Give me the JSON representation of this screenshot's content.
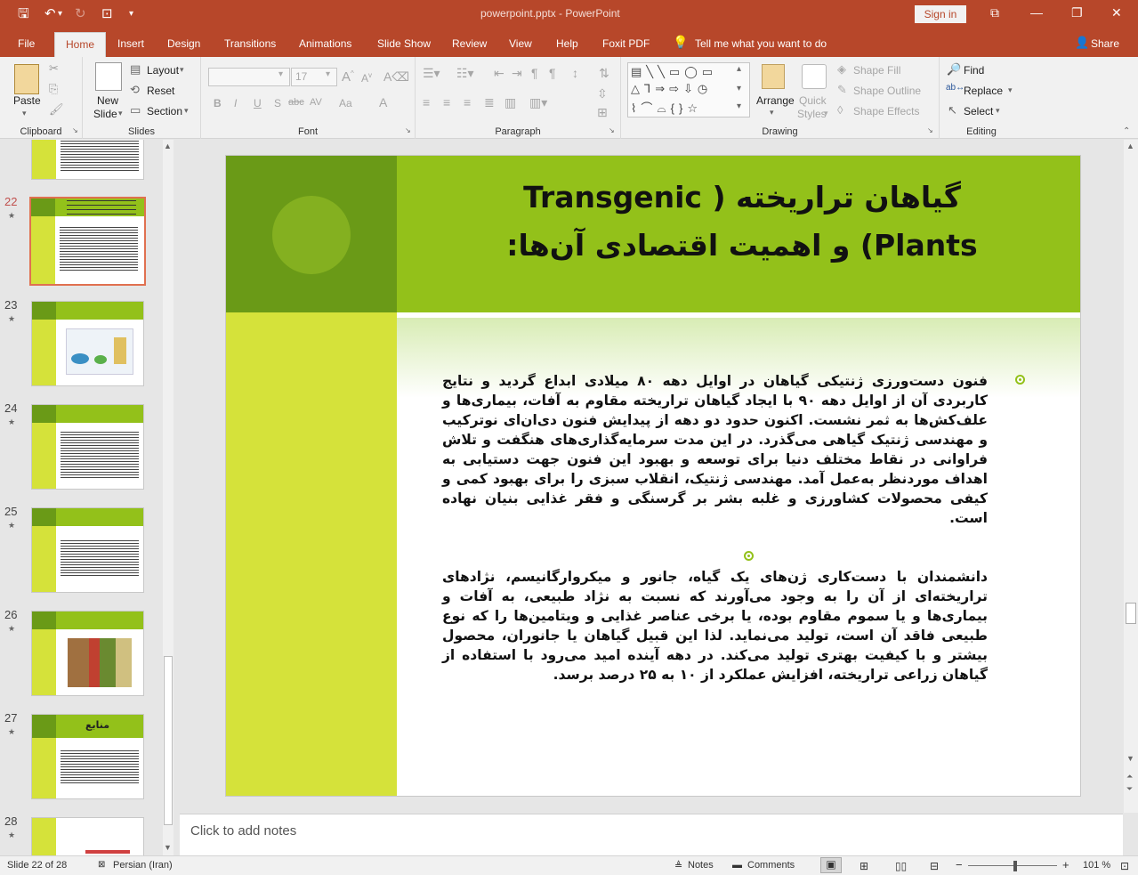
{
  "titlebar": {
    "title": "powerpoint.pptx  -  PowerPoint",
    "signin": "Sign in",
    "save_icon": "save-icon",
    "undo_icon": "undo-icon",
    "redo_icon": "redo-icon",
    "min": "—",
    "restore": "❐",
    "close": "✕",
    "restore_icon": "⧉"
  },
  "tabs": [
    "File",
    "Home",
    "Insert",
    "Design",
    "Transitions",
    "Animations",
    "Slide Show",
    "Review",
    "View",
    "Help",
    "Foxit PDF"
  ],
  "tell_me": "Tell me what you want to do",
  "share": "Share",
  "ribbon": {
    "clipboard": {
      "paste": "Paste",
      "label": "Clipboard"
    },
    "slides": {
      "new_slide": "New",
      "new_slide2": "Slide",
      "layout": "Layout",
      "reset": "Reset",
      "section": "Section",
      "label": "Slides"
    },
    "font": {
      "size": "17",
      "label": "Font",
      "b": "B",
      "i": "I",
      "u": "U",
      "s": "S",
      "abc": "abc",
      "av": "AV",
      "aa": "Aa",
      "a": "A"
    },
    "paragraph": {
      "label": "Paragraph"
    },
    "drawing": {
      "arrange": "Arrange",
      "quick": "Quick",
      "styles": "Styles",
      "shape_fill": "Shape Fill",
      "shape_outline": "Shape Outline",
      "shape_effects": "Shape Effects",
      "label": "Drawing"
    },
    "editing": {
      "find": "Find",
      "replace": "Replace",
      "select": "Select",
      "label": "Editing"
    }
  },
  "thumbnails": [
    {
      "num": "22",
      "star": "★"
    },
    {
      "num": "23",
      "star": "★"
    },
    {
      "num": "24",
      "star": "★"
    },
    {
      "num": "25",
      "star": "★"
    },
    {
      "num": "26",
      "star": "★"
    },
    {
      "num": "27",
      "star": "★",
      "title": "منابع"
    },
    {
      "num": "28",
      "star": "★"
    }
  ],
  "slide": {
    "title_line1": "گیاهان تراریخته ( Transgenic",
    "title_line2": "Plants) و اهمیت اقتصادی آن‌ها:",
    "para1": "فنون دست‌ورزی ژنتیکی گیاهان در اوایل دهه ۸۰ میلادی ابداع گردید و نتایج کاربردی آن از اوایل دهه ۹۰ با ایجاد گیاهان تراریخته مقاوم به آفات، بیماری‌ها و علف‌کش‌ها به ثمر نشست. اکنون حدود دو دهه از پیدایش فنون دی‌ان‌ای نوترکیب و مهندسی ژنتیک گیاهی می‌گذرد. در این مدت سرمایه‌گذاری‌های هنگفت و تلاش فراوانی در نقاط مختلف دنیا برای توسعه و بهبود این فنون جهت دستیابی به اهداف موردنظر به‌عمل آمد. مهندسی ژنتیک، انقلاب سبزی را برای بهبود کمی و کیفی محصولات کشاورزی و غلبه بشر بر گرسنگی و فقر غذایی بنیان نهاده است.",
    "para2": "دانشمندان با دست‌کاری ژن‌های یک گیاه، جانور و میکروارگانیسم، نژادهای تراریخته‌ای از آن را به وجود می‌آورند که نسبت به نژاد طبیعی، به آفات و بیماری‌ها و یا سموم مقاوم بوده، یا برخی عناصر غذایی و ویتامین‌ها را که نوع طبیعی فاقد آن است، تولید می‌نماید. لذا این قبیل گیاهان یا جانوران، محصول بیشتر و با کیفیت بهتری تولید می‌کند. در دهه آینده امید می‌رود با استفاده از گیاهان زراعی تراریخته، افزایش عملکرد از ۱۰ به ۲۵ درصد برسد."
  },
  "notes_placeholder": "Click to add notes",
  "status": {
    "slide": "Slide 22 of 28",
    "lang": "Persian (Iran)",
    "notes": "Notes",
    "comments": "Comments",
    "zoom": "101 %",
    "minus": "−",
    "plus": "+"
  },
  "colors": {
    "accent": "#b7472a",
    "green_dark": "#6a9a17",
    "green": "#93c11a",
    "green_light": "#d5e23a"
  }
}
